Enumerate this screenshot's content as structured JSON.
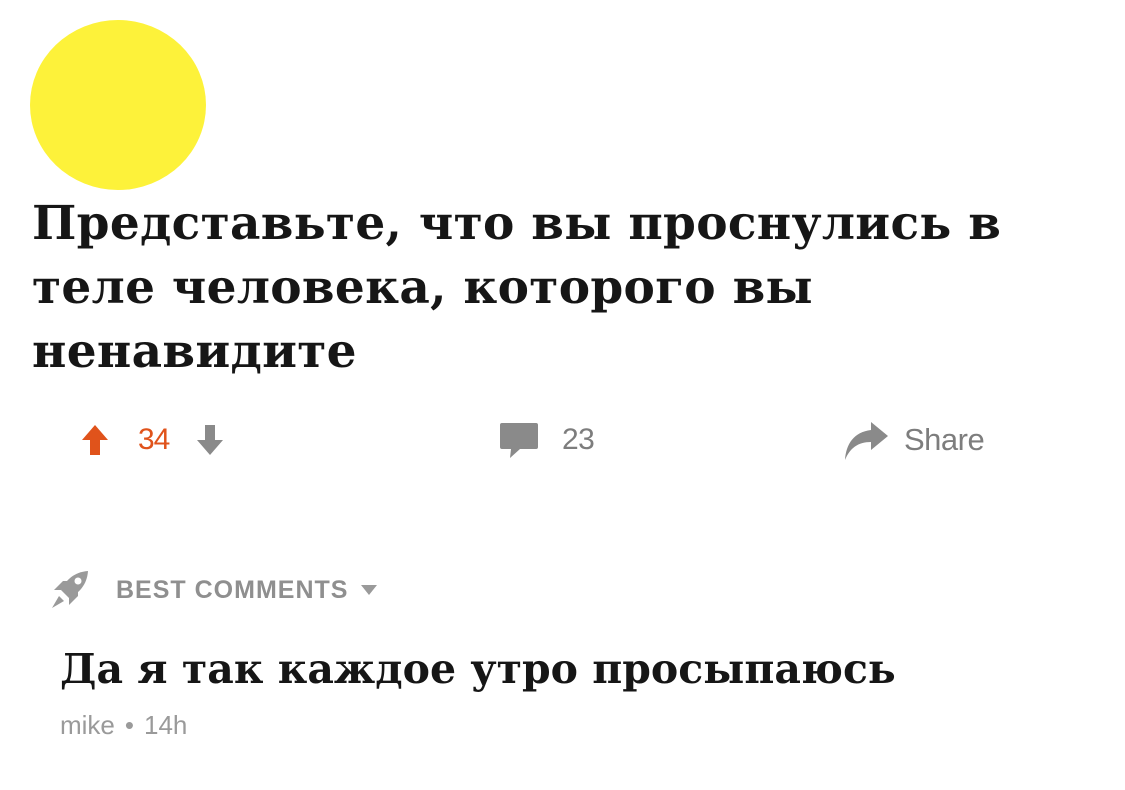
{
  "post": {
    "title": "Представьте, что вы проснулись в теле человека, которого вы ненавидите",
    "score": "34",
    "comment_count": "23",
    "share_label": "Share"
  },
  "comments_section": {
    "header_label": "BEST COMMENTS",
    "items": [
      {
        "body": "Да я так каждое утро просыпаюсь",
        "author": "mike",
        "separator": "•",
        "age": "14h"
      }
    ]
  },
  "icons": {
    "avatar": "avatar",
    "upvote": "upvote-arrow-icon",
    "downvote": "downvote-arrow-icon",
    "comment": "comment-bubble-icon",
    "share": "share-arrow-icon",
    "sort": "rocket-icon",
    "dropdown": "chevron-down-icon"
  },
  "colors": {
    "avatar": "#fdf23a",
    "upvote_active": "#e0531b",
    "muted": "#7d7d7d",
    "text": "#161616"
  }
}
